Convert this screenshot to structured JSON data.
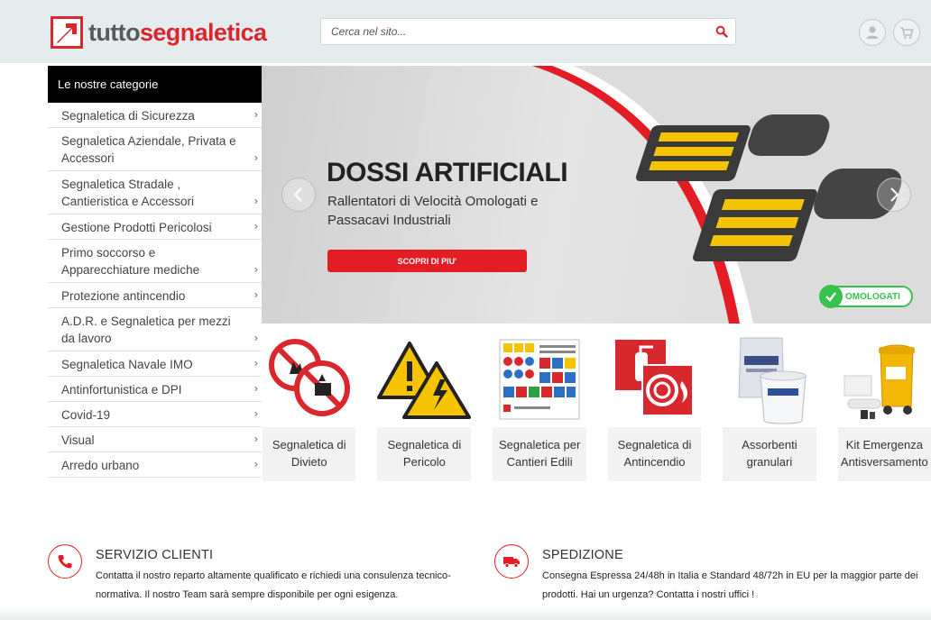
{
  "header": {
    "logo_part1": "tutto",
    "logo_part2": "segnaletica",
    "search_placeholder": "Cerca nel sito...",
    "icons": [
      "search-icon",
      "user-icon",
      "cart-icon"
    ]
  },
  "sidebar": {
    "title": "Le nostre categorie",
    "items": [
      {
        "label": "Segnaletica di Sicurezza"
      },
      {
        "label": "Segnaletica Aziendale, Privata e Accessori"
      },
      {
        "label": "Segnaletica Stradale , Cantieristica e Accessori"
      },
      {
        "label": "Gestione Prodotti Pericolosi"
      },
      {
        "label": "Primo soccorso e Apparecchiature mediche"
      },
      {
        "label": "Protezione antincendio"
      },
      {
        "label": "A.D.R. e Segnaletica per mezzi da lavoro"
      },
      {
        "label": "Segnaletica Navale IMO"
      },
      {
        "label": "Antinfortunistica e DPI"
      },
      {
        "label": "Covid-19"
      },
      {
        "label": "Visual"
      },
      {
        "label": "Arredo urbano"
      }
    ],
    "chevron": "›"
  },
  "banner": {
    "title": "DOSSI ARTIFICIALI",
    "subtitle": "Rallentatori di Velocità Omologati e Passacavi Industriali",
    "cta": "SCOPRI DI PIU'",
    "badge": "OMOLOGATI",
    "prev_icon": "chevron-left-icon",
    "next_icon": "chevron-right-icon",
    "brand_red": "#e41c24"
  },
  "products": [
    {
      "line1": "Segnaletica di",
      "line2": "Divieto"
    },
    {
      "line1": "Segnaletica di",
      "line2": "Pericolo"
    },
    {
      "line1": "Segnaletica per",
      "line2": "Cantieri Edili"
    },
    {
      "line1": "Segnaletica di",
      "line2": "Antincendio"
    },
    {
      "line1": "Assorbenti",
      "line2": "granulari"
    },
    {
      "line1": "Kit Emergenza",
      "line2": "Antisversamento"
    }
  ],
  "info": {
    "service": {
      "title": "SERVIZIO CLIENTI",
      "line1": "Contatta il nostro reparto altamente qualificato e richiedi una consulenza tecnico-",
      "line2": "normativa. Il nostro Team sarà sempre disponibile per ogni esigenza."
    },
    "shipping": {
      "title": "SPEDIZIONE",
      "line1": "Consegna Espressa 24/48h in Italia e Standard 48/72h in EU per la maggior parte dei",
      "line2": "prodotti. Hai un urgenza? Contatta i nostri uffici !"
    }
  }
}
